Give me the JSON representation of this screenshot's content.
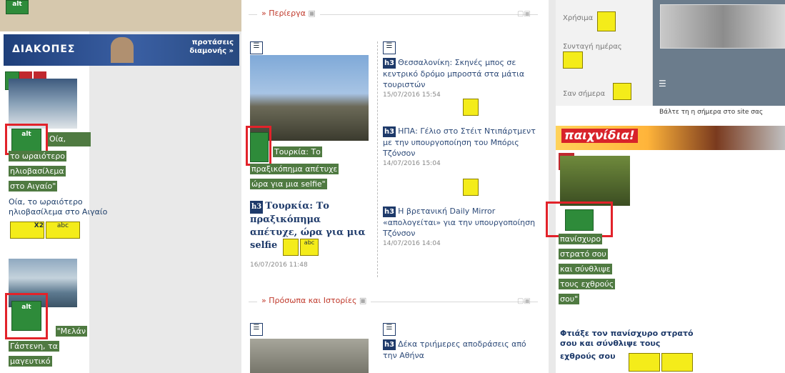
{
  "left": {
    "banner_logo": "ΔΙΑΚΟΠΕΣ",
    "banner_tag_line1": "προτάσεις",
    "banner_tag_line2": "διαμονής »",
    "alt_label": "alt",
    "highlight_lines": [
      "Οία,",
      "το ωραιότερο",
      "ηλιοβασίλεμα",
      "στο Αιγαίο\""
    ],
    "link_line1": "Οία, το ωραιότερο",
    "link_line2": "ηλιοβασίλεμα στο Αιγαίο",
    "x2_label": "X2",
    "abc_label": "abc",
    "highlight2_lines": [
      "\"Μελάν",
      "Γάστενη, τα",
      "μαγευτικό"
    ]
  },
  "middle": {
    "section1_title": "Περίεργα",
    "main_story_highlight": [
      "Τουρκία: Το",
      "πραξικόπημα απέτυχε",
      "ώρα για μια selfie\""
    ],
    "main_story_h3": "h3",
    "main_story_title": "Τουρκία: Το πραξικόπημα απέτυχε, ώρα για μια selfie",
    "main_story_date": "16/07/2016 11:48",
    "news": [
      {
        "title": "Θεσσαλονίκη: Σκηνές μπος σε κεντρικό δρόμο μπροστά στα μάτια τουριστών",
        "date": "15/07/2016 15:54"
      },
      {
        "title": "ΗΠΑ: Γέλιο στο Στέιτ Ντιπάρτμεντ με την υπουργοποίηση του Μπόρις Τζόνσον",
        "date": "14/07/2016 15:04"
      },
      {
        "title": "Η βρετανική Daily Mirror «απολογείται» για την υπουργοποίηση Τζόνσον",
        "date": "14/07/2016 14:04"
      }
    ],
    "section2_title": "Πρόσωπα και Ιστορίες",
    "bottom_news_title": "Δέκα τριήμερες αποδράσεις από την Αθήνα"
  },
  "right": {
    "top_items": [
      "Χρήσιμα",
      "Συνταγή ημέρας",
      "Σαν σήμερα"
    ],
    "put_line": "Βάλτε τη η σήμερα στο site σας",
    "games_banner": "παιχνίδια!",
    "highlight_lines": [
      "πανίσχυρο",
      "στρατό σου",
      "και σύνθλιψε",
      "τους εχθρούς",
      "σου\""
    ],
    "link_line1": "Φτιάξε τον πανίσχυρο στρατό",
    "link_line2": "σου και σύνθλιψε τους",
    "link_line3": "εχθρούς σου"
  },
  "colors": {
    "highlight": "#4f7a41",
    "redbox": "#e2222a",
    "yellow": "#f4ec1a"
  }
}
